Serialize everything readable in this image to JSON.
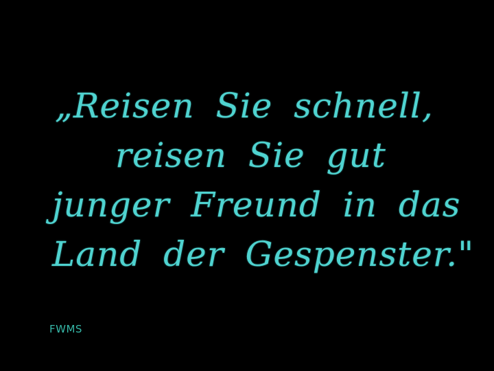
{
  "intertitle": {
    "lines": [
      "„Reisen Sie schnell,",
      "reisen Sie gut",
      "junger Freund in das",
      "Land der Gespenster.\""
    ],
    "text_color": "#4fd3d0"
  },
  "watermark": {
    "text": "FWMS",
    "color": "#36b8a8"
  },
  "background_color": "#000000"
}
